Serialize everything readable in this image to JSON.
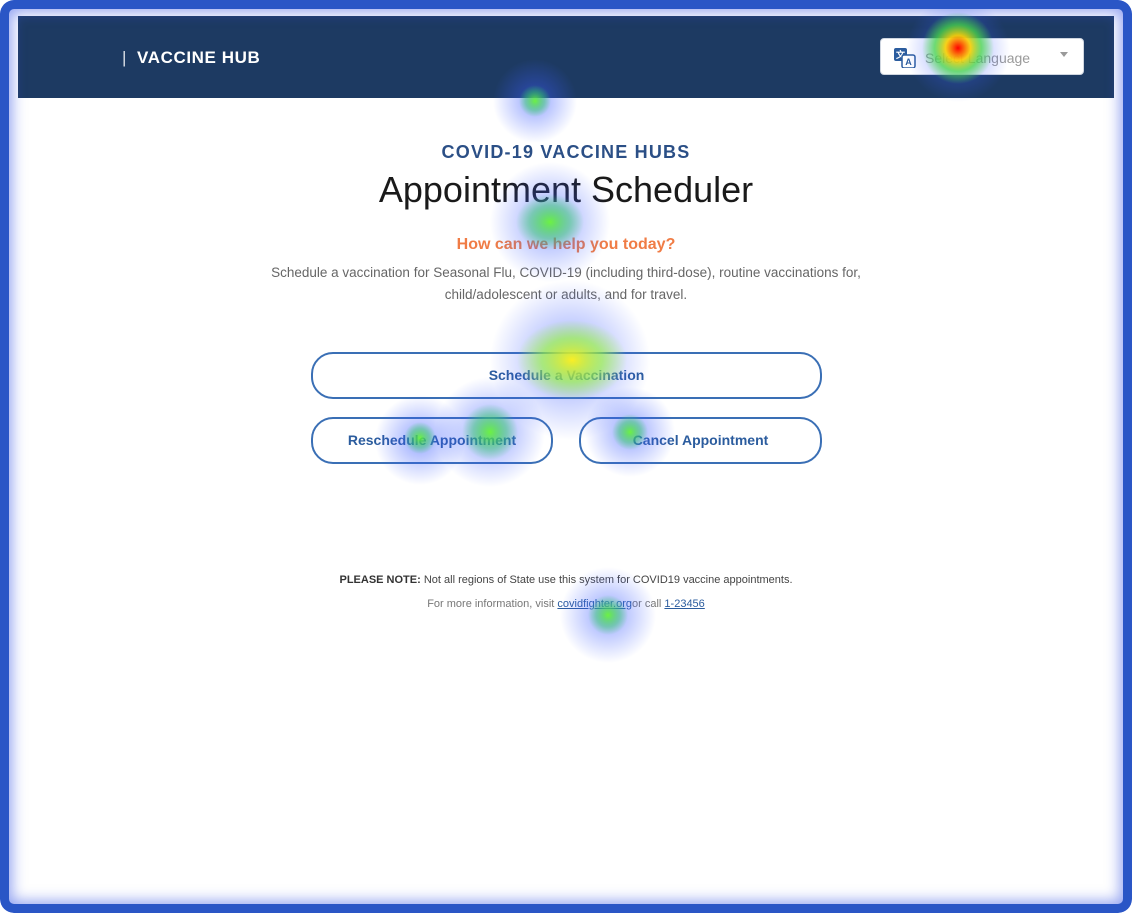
{
  "header": {
    "separator": "|",
    "brand": "VACCINE HUB",
    "language_select": {
      "value": "Select Language",
      "icon": "translate-icon"
    }
  },
  "hero": {
    "eyebrow": "COVID-19 VACCINE HUBS",
    "title": "Appointment Scheduler"
  },
  "prompt": "How can we help you today?",
  "description": "Schedule a vaccination for Seasonal Flu, COVID-19 (including third-dose), routine vaccinations for, child/adolescent or adults, and for travel.",
  "actions": {
    "schedule": "Schedule a Vaccination",
    "reschedule": "Reschedule Appointment",
    "cancel": "Cancel Appointment"
  },
  "footer": {
    "note_label": "PLEASE NOTE:",
    "note_text": "Not all regions of State use this system for COVID19 vaccine appointments.",
    "info_prefix": "For more information, visit",
    "info_link": "covidfighter.org",
    "info_middle": "or call",
    "phone_link": "1-23456"
  },
  "colors": {
    "header_bg": "#1d3a62",
    "accent_blue": "#2b5c9e",
    "prompt_orange": "#f07c45",
    "frame_blue": "#2a56c6"
  }
}
